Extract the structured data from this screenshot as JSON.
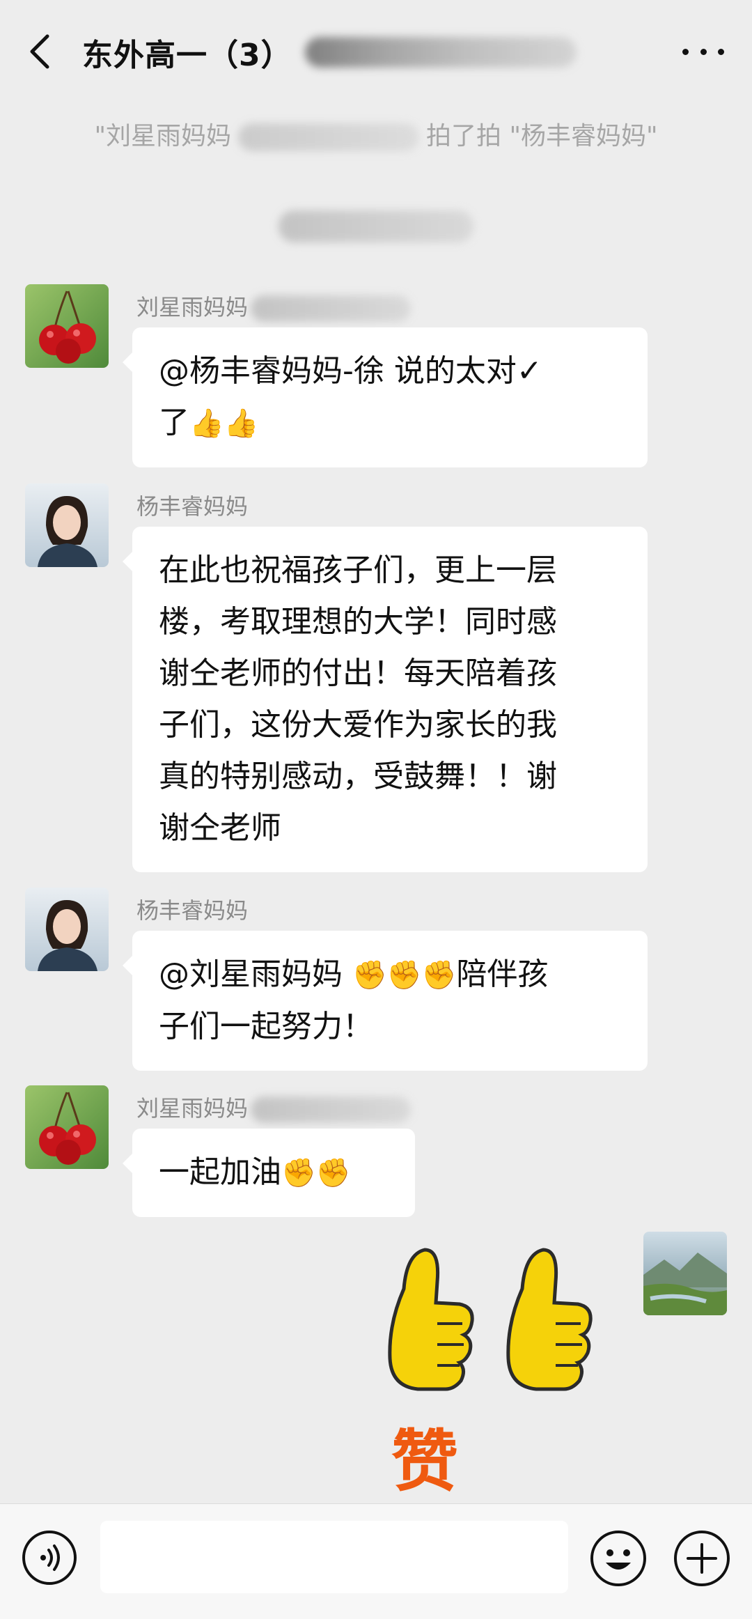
{
  "header": {
    "title": "东外高一（3）"
  },
  "system_notices": {
    "pat_prefix": "\"刘星雨妈妈",
    "pat_suffix": "拍了拍 \"杨丰睿妈妈\""
  },
  "messages": [
    {
      "sender": "刘星雨妈妈",
      "text_line1": "@杨丰睿妈妈-徐  说的太对✓",
      "text_line2": "了",
      "emojis": "👍👍"
    },
    {
      "sender": "杨丰睿妈妈",
      "lines": [
        "在此也祝福孩子们，更上一层",
        "楼，考取理想的大学！同时感",
        "谢仝老师的付出！每天陪着孩",
        "子们，这份大爱作为家长的我",
        "真的特别感动，受鼓舞！！谢",
        "谢仝老师"
      ]
    },
    {
      "sender": "杨丰睿妈妈",
      "text_prefix": "@刘星雨妈妈 ",
      "emojis": "✊✊✊",
      "text_suffix": "陪伴孩",
      "text_line2": "子们一起努力！"
    },
    {
      "sender": "刘星雨妈妈",
      "text": "一起加油",
      "emojis": "✊✊"
    }
  ],
  "sticker": {
    "caption": "赞",
    "colors": {
      "thumb": "#f5d20a",
      "outline": "#2b2b2b",
      "caption": "#ef5a10"
    }
  },
  "input_bar": {
    "placeholder": ""
  },
  "colors": {
    "background": "#ededed",
    "bubble": "#ffffff",
    "notice_text": "#a6a6a6",
    "sender_text": "#8a8a8a"
  }
}
